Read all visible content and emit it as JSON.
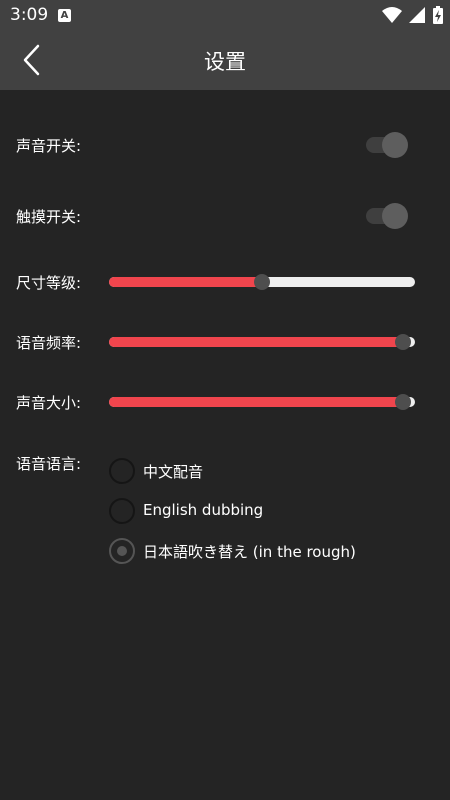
{
  "status_bar": {
    "time": "3:09",
    "notification_icon_letter": "A",
    "icons": [
      "wifi-icon",
      "signal-icon",
      "battery-charging-icon"
    ]
  },
  "toolbar": {
    "title": "设置",
    "back_icon": "chevron-left-icon"
  },
  "settings": {
    "sound_switch": {
      "label": "声音开关:",
      "on": false
    },
    "touch_switch": {
      "label": "触摸开关:",
      "on": false
    },
    "size_level": {
      "label": "尺寸等级:",
      "value": 0.5
    },
    "voice_rate": {
      "label": "语音频率:",
      "value": 0.96
    },
    "volume": {
      "label": "声音大小:",
      "value": 0.96
    },
    "voice_language": {
      "label": "语音语言:",
      "options": [
        "中文配音",
        "English dubbing",
        "日本語吹き替え (in the rough)"
      ],
      "selected_index": 2
    }
  },
  "colors": {
    "accent": "#f0454d",
    "background": "#242424",
    "toolbar": "#414141"
  }
}
